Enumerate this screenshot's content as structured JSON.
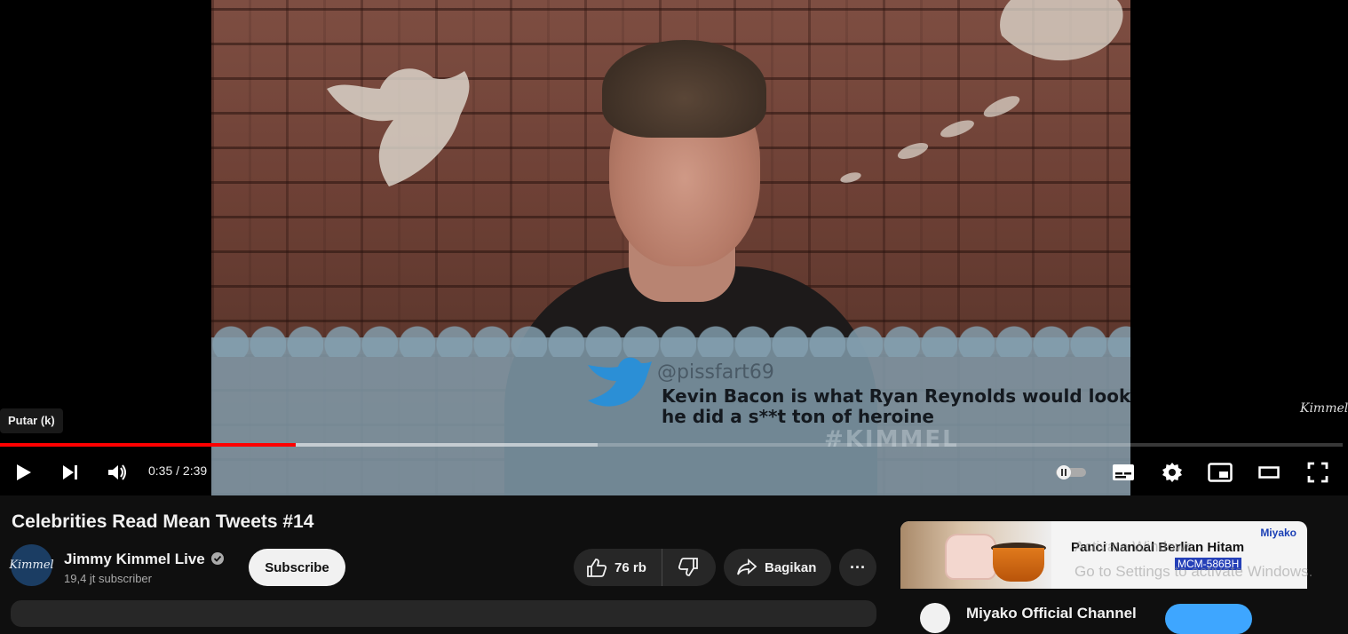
{
  "player": {
    "tooltip": "Putar (k)",
    "time_current": "0:35",
    "time_separator": " / ",
    "time_total": "2:39",
    "progress_played_fraction": 0.22,
    "progress_buffered_fraction": 0.445,
    "video": {
      "tweet_handle": "@pissfart69",
      "tweet_text": "Kevin Bacon is what Ryan Reynolds would look like if he did a s**t ton of heroine",
      "hashtag": "#KIMMEL",
      "watermark": "Kimmel"
    },
    "icons": [
      "play-icon",
      "next-icon",
      "volume-icon",
      "autoplay-toggle-icon",
      "subtitles-icon",
      "settings-icon",
      "miniplayer-icon",
      "theater-icon",
      "fullscreen-icon"
    ],
    "accent_color": "#ff0000"
  },
  "video_info": {
    "title": "Celebrities Read Mean Tweets #14",
    "channel_name": "Jimmy Kimmel Live",
    "subscriber_count": "19,4 jt subscriber",
    "subscribe_label": "Subscribe",
    "like_count": "76 rb",
    "share_label": "Bagikan",
    "more_label": "···"
  },
  "ad": {
    "brand": "Miyako",
    "title": "Panci Nanoal Berlian Hitam",
    "model": "MCM-586BH",
    "channel": "Miyako Official Channel"
  },
  "os_overlay": {
    "line1": "Activate Windows",
    "line2": "Go to Settings to activate Windows."
  }
}
